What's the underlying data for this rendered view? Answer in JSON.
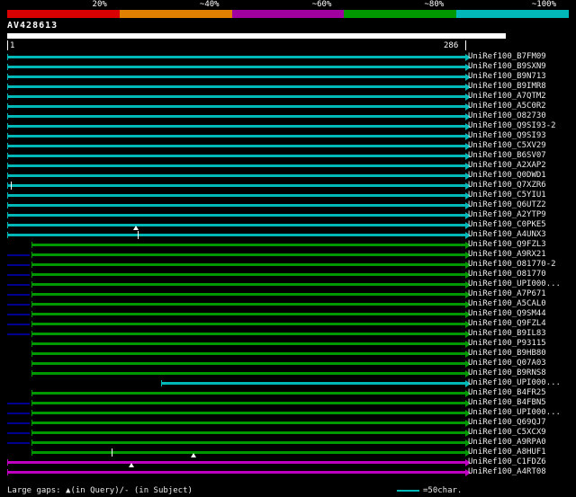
{
  "header": {
    "query_name": "AV428613"
  },
  "ruler": {
    "start": "1",
    "end": "286"
  },
  "footer": {
    "gaps_legend": "Large gaps: ▲(in Query)/- (in Subject)",
    "scale_label": "=50char."
  },
  "colors": {
    "background": "#000000",
    "cyan": "#00b8b8",
    "green": "#009800",
    "magenta": "#c000c0",
    "low_segment": "#000090",
    "gap_marker": "#ffffff",
    "query_bar": "#ffffff",
    "text": "#e8e8e8"
  },
  "chart_data": {
    "type": "bar",
    "title": "AV428613",
    "xlabel": "query position",
    "ylabel": "",
    "x_range": [
      1,
      286
    ],
    "legend_position": "top",
    "legend": [
      {
        "label": "20%",
        "color": "#d80000"
      },
      {
        "label": "~40%",
        "color": "#e08000"
      },
      {
        "label": "~60%",
        "color": "#a000a0"
      },
      {
        "label": "~80%",
        "color": "#009800"
      },
      {
        "label": "~100%",
        "color": "#00b8b8"
      }
    ],
    "rows": [
      {
        "label": "UniRef100_B7FM09",
        "color": "cyan",
        "start": 1,
        "end": 286
      },
      {
        "label": "UniRef100_B9SXN9",
        "color": "cyan",
        "start": 1,
        "end": 286
      },
      {
        "label": "UniRef100_B9N713",
        "color": "cyan",
        "start": 1,
        "end": 286
      },
      {
        "label": "UniRef100_B9IMR8",
        "color": "cyan",
        "start": 1,
        "end": 286
      },
      {
        "label": "UniRef100_A7QTM2",
        "color": "cyan",
        "start": 1,
        "end": 286
      },
      {
        "label": "UniRef100_A5C0R2",
        "color": "cyan",
        "start": 1,
        "end": 286
      },
      {
        "label": "UniRef100_O82730",
        "color": "cyan",
        "start": 1,
        "end": 286
      },
      {
        "label": "UniRef100_Q9SI93-2",
        "color": "cyan",
        "start": 1,
        "end": 286
      },
      {
        "label": "UniRef100_Q9SI93",
        "color": "cyan",
        "start": 1,
        "end": 286
      },
      {
        "label": "UniRef100_C5XV29",
        "color": "cyan",
        "start": 1,
        "end": 286
      },
      {
        "label": "UniRef100_B6SV07",
        "color": "cyan",
        "start": 1,
        "end": 286
      },
      {
        "label": "UniRef100_A2XAP2",
        "color": "cyan",
        "start": 1,
        "end": 286
      },
      {
        "label": "UniRef100_Q0DWD1",
        "color": "cyan",
        "start": 1,
        "end": 286
      },
      {
        "label": "UniRef100_Q7XZR6",
        "color": "cyan",
        "start": 1,
        "end": 286,
        "markers": [
          {
            "type": "tick",
            "pos": 3
          }
        ]
      },
      {
        "label": "UniRef100_C5YIU1",
        "color": "cyan",
        "start": 1,
        "end": 286
      },
      {
        "label": "UniRef100_Q6UTZ2",
        "color": "cyan",
        "start": 1,
        "end": 286
      },
      {
        "label": "UniRef100_A2YTP9",
        "color": "cyan",
        "start": 1,
        "end": 286
      },
      {
        "label": "UniRef100_C0PKE5",
        "color": "cyan",
        "start": 1,
        "end": 286,
        "markers": [
          {
            "type": "triangle",
            "pos": 81,
            "place": "below"
          }
        ]
      },
      {
        "label": "UniRef100_A4UNX3",
        "color": "cyan",
        "start": 1,
        "end": 286,
        "markers": [
          {
            "type": "tick",
            "pos": 82
          }
        ]
      },
      {
        "label": "UniRef100_Q9FZL3",
        "color": "green",
        "start": 16,
        "end": 286
      },
      {
        "label": "UniRef100_A9RX21",
        "color": "green",
        "start": 16,
        "end": 286,
        "prefix_end": 15
      },
      {
        "label": "UniRef100_O81770-2",
        "color": "green",
        "start": 16,
        "end": 286,
        "prefix_end": 15
      },
      {
        "label": "UniRef100_O81770",
        "color": "green",
        "start": 16,
        "end": 286,
        "prefix_end": 15
      },
      {
        "label": "UniRef100_UPI000...",
        "color": "green",
        "start": 16,
        "end": 286,
        "prefix_end": 15
      },
      {
        "label": "UniRef100_A7P671",
        "color": "green",
        "start": 16,
        "end": 286,
        "prefix_end": 15
      },
      {
        "label": "UniRef100_A5CAL0",
        "color": "green",
        "start": 16,
        "end": 286,
        "prefix_end": 15
      },
      {
        "label": "UniRef100_Q9SM44",
        "color": "green",
        "start": 16,
        "end": 286,
        "prefix_end": 15
      },
      {
        "label": "UniRef100_Q9FZL4",
        "color": "green",
        "start": 16,
        "end": 286,
        "prefix_end": 15
      },
      {
        "label": "UniRef100_B9IL83",
        "color": "green",
        "start": 16,
        "end": 286,
        "prefix_end": 15
      },
      {
        "label": "UniRef100_P93115",
        "color": "green",
        "start": 16,
        "end": 286
      },
      {
        "label": "UniRef100_B9HB80",
        "color": "green",
        "start": 16,
        "end": 286
      },
      {
        "label": "UniRef100_Q07A03",
        "color": "green",
        "start": 16,
        "end": 286
      },
      {
        "label": "UniRef100_B9RNS8",
        "color": "green",
        "start": 16,
        "end": 286
      },
      {
        "label": "UniRef100_UPI000...",
        "color": "cyan",
        "start": 97,
        "end": 286
      },
      {
        "label": "UniRef100_B4FR25",
        "color": "green",
        "start": 16,
        "end": 286
      },
      {
        "label": "UniRef100_B4FBN5",
        "color": "green",
        "start": 16,
        "end": 286,
        "prefix_end": 15
      },
      {
        "label": "UniRef100_UPI000...",
        "color": "green",
        "start": 16,
        "end": 286,
        "prefix_end": 15
      },
      {
        "label": "UniRef100_Q69QJ7",
        "color": "green",
        "start": 16,
        "end": 286,
        "prefix_end": 15
      },
      {
        "label": "UniRef100_C5XCX9",
        "color": "green",
        "start": 16,
        "end": 286,
        "prefix_end": 15
      },
      {
        "label": "UniRef100_A9RPA0",
        "color": "green",
        "start": 16,
        "end": 286,
        "prefix_end": 15
      },
      {
        "label": "UniRef100_A8HUF1",
        "color": "green",
        "start": 16,
        "end": 286,
        "markers": [
          {
            "type": "tick",
            "pos": 66
          },
          {
            "type": "triangle",
            "pos": 117,
            "place": "below"
          }
        ]
      },
      {
        "label": "UniRef100_C1FDZ6",
        "color": "magenta",
        "start": 1,
        "end": 286,
        "markers": [
          {
            "type": "triangle",
            "pos": 78,
            "place": "below"
          }
        ]
      },
      {
        "label": "UniRef100_A4RT08",
        "color": "magenta",
        "start": 1,
        "end": 286
      }
    ]
  }
}
